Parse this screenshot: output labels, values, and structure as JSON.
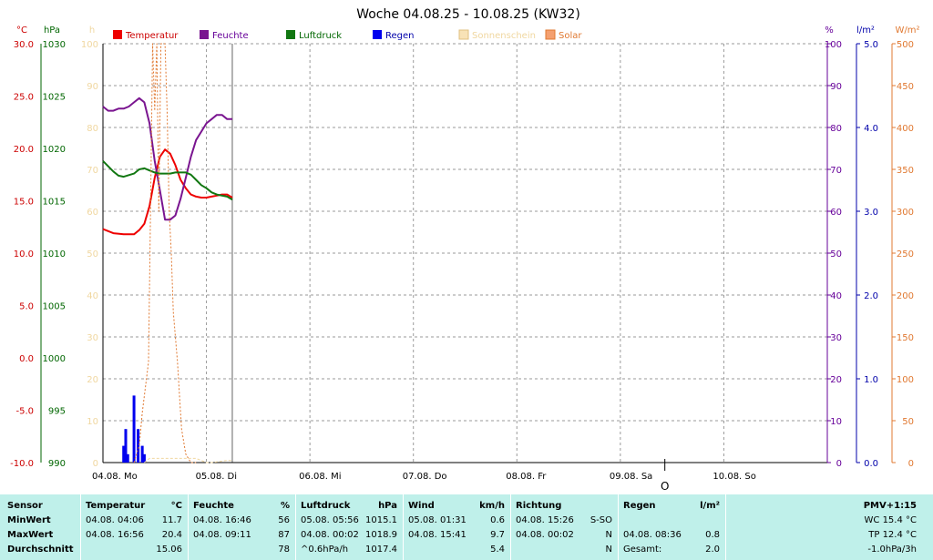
{
  "chart_data": {
    "type": "line",
    "title": "Woche 04.08.25 - 10.08.25 (KW32)",
    "x_days": [
      "04.08.  Mo",
      "05.08.  Di",
      "06.08.  Mi",
      "07.08.  Do",
      "08.08.  Fr",
      "09.08.  Sa",
      "10.08.  So"
    ],
    "x_range_days": [
      0,
      7
    ],
    "now_marker_day": 5.43,
    "now_marker_label": "O",
    "grid": true,
    "legend_position": "top",
    "axes": {
      "temp": {
        "unit": "°C",
        "range": [
          -10,
          30
        ],
        "ticks": [
          "30.0",
          "25.0",
          "20.0",
          "15.0",
          "10.0",
          "5.0",
          "0.0",
          "-5.0",
          "-10.0"
        ],
        "color": "#cc0000"
      },
      "press": {
        "unit": "hPa",
        "range": [
          990,
          1030
        ],
        "ticks": [
          "1030",
          "1025",
          "1020",
          "1015",
          "1010",
          "1005",
          "1000",
          "995",
          "990"
        ],
        "color": "#006600"
      },
      "sun": {
        "unit": "h",
        "range": [
          0,
          100
        ],
        "ticks": [
          "100",
          "90",
          "80",
          "70",
          "60",
          "50",
          "40",
          "30",
          "20",
          "10",
          "0"
        ],
        "color": "#f0d7a0"
      },
      "hum": {
        "unit": "%",
        "range": [
          0,
          100
        ],
        "ticks": [
          "100",
          "90",
          "80",
          "70",
          "60",
          "50",
          "40",
          "30",
          "20",
          "10",
          "0"
        ],
        "color": "#660099"
      },
      "rain": {
        "unit": "l/m²",
        "range": [
          0,
          5
        ],
        "ticks": [
          "5.0",
          "4.0",
          "3.0",
          "2.0",
          "1.0",
          "0.0"
        ],
        "color": "#0000aa"
      },
      "solar": {
        "unit": "W/m²",
        "range": [
          0,
          500
        ],
        "ticks": [
          "500",
          "450",
          "400",
          "350",
          "300",
          "250",
          "200",
          "150",
          "100",
          "50",
          "0"
        ],
        "color": "#e07830"
      }
    },
    "series": [
      {
        "name": "Temperatur",
        "axis": "temp",
        "color": "#ee0000",
        "style": "line",
        "x": [
          0,
          0.05,
          0.1,
          0.2,
          0.3,
          0.35,
          0.4,
          0.45,
          0.5,
          0.55,
          0.6,
          0.65,
          0.7,
          0.75,
          0.8,
          0.85,
          0.9,
          0.95,
          1.0,
          1.05,
          1.1,
          1.15,
          1.2,
          1.25
        ],
        "y": [
          12.3,
          12.1,
          11.9,
          11.8,
          11.8,
          12.2,
          12.8,
          14.5,
          17.2,
          19.2,
          19.9,
          19.5,
          18.4,
          17.0,
          16.2,
          15.6,
          15.4,
          15.3,
          15.3,
          15.4,
          15.5,
          15.6,
          15.6,
          15.3
        ]
      },
      {
        "name": "Feuchte",
        "axis": "hum",
        "color": "#7a1590",
        "style": "line",
        "x": [
          0,
          0.05,
          0.1,
          0.15,
          0.2,
          0.25,
          0.3,
          0.35,
          0.4,
          0.45,
          0.5,
          0.55,
          0.6,
          0.65,
          0.7,
          0.75,
          0.8,
          0.85,
          0.9,
          0.95,
          1.0,
          1.05,
          1.1,
          1.15,
          1.2,
          1.25
        ],
        "y": [
          85,
          84,
          84,
          84.5,
          84.5,
          85,
          86,
          87,
          86,
          81,
          72,
          65,
          58,
          58,
          59,
          63,
          68,
          73,
          77,
          79,
          81,
          82,
          83,
          83,
          82,
          82
        ]
      },
      {
        "name": "Luftdruck",
        "axis": "press",
        "color": "#117711",
        "style": "line",
        "x": [
          0,
          0.05,
          0.1,
          0.15,
          0.2,
          0.3,
          0.35,
          0.4,
          0.45,
          0.5,
          0.55,
          0.6,
          0.65,
          0.7,
          0.75,
          0.8,
          0.85,
          0.9,
          0.95,
          1.0,
          1.05,
          1.1,
          1.15,
          1.2,
          1.25
        ],
        "y": [
          1018.8,
          1018.3,
          1017.8,
          1017.4,
          1017.3,
          1017.6,
          1018.0,
          1018.1,
          1017.9,
          1017.7,
          1017.6,
          1017.6,
          1017.6,
          1017.7,
          1017.7,
          1017.7,
          1017.5,
          1017.0,
          1016.5,
          1016.2,
          1015.8,
          1015.6,
          1015.5,
          1015.4,
          1015.1
        ]
      },
      {
        "name": "Regen",
        "axis": "rain",
        "color": "#0000ee",
        "style": "bars",
        "x": [
          0.2,
          0.22,
          0.24,
          0.3,
          0.34,
          0.38,
          0.4
        ],
        "y": [
          0.2,
          0.4,
          0.1,
          0.8,
          0.4,
          0.2,
          0.1
        ]
      },
      {
        "name": "Sonnenschein",
        "axis": "sun",
        "color": "#f0d7a0",
        "style": "line",
        "x": [
          0.4,
          0.45,
          0.5,
          0.6,
          0.7,
          0.8,
          0.9,
          1.0,
          1.05,
          1.2,
          1.25
        ],
        "y": [
          0,
          1,
          1,
          1,
          1,
          1,
          1,
          0,
          0,
          0.5,
          0.5
        ]
      },
      {
        "name": "Solar",
        "axis": "solar",
        "color": "#e07830",
        "style": "dash",
        "x": [
          0.3,
          0.35,
          0.38,
          0.41,
          0.44,
          0.46,
          0.48,
          0.5,
          0.52,
          0.54,
          0.56,
          0.58,
          0.6,
          0.62,
          0.64,
          0.66,
          0.68,
          0.7,
          0.72,
          0.74,
          0.76,
          0.8,
          0.85,
          0.9
        ],
        "y": [
          0,
          20,
          60,
          90,
          120,
          300,
          500,
          420,
          500,
          300,
          500,
          500,
          500,
          420,
          300,
          250,
          180,
          150,
          120,
          80,
          40,
          10,
          0,
          0
        ]
      }
    ]
  },
  "stats": {
    "headers": {
      "sensor": "Sensor",
      "temp": "Temperatur",
      "temp_unit": "°C",
      "hum": "Feuchte",
      "hum_unit": "%",
      "press": "Luftdruck",
      "press_unit": "hPa",
      "wind": "Wind",
      "wind_unit": "km/h",
      "dir": "Richtung",
      "rain": "Regen",
      "rain_unit": "l/m²",
      "pmv": "PMV+1:15"
    },
    "rows": {
      "min": {
        "label": "MinWert",
        "temp_time": "04.08.  04:06",
        "temp_val": "11.7",
        "hum_time": "04.08.  16:46",
        "hum_val": "56",
        "press_time": "05.08.  05:56",
        "press_val": "1015.1",
        "wind_time": "05.08.  01:31",
        "wind_val": "0.6",
        "dir_time": "04.08.  15:26",
        "dir_val": "S-SO",
        "rain_time": "",
        "rain_val": "",
        "extra": "WC 15.4 °C"
      },
      "max": {
        "label": "MaxWert",
        "temp_time": "04.08.  16:56",
        "temp_val": "20.4",
        "hum_time": "04.08.  09:11",
        "hum_val": "87",
        "press_time": "04.08.  00:02",
        "press_val": "1018.9",
        "wind_time": "04.08.  15:41",
        "wind_val": "9.7",
        "dir_time": "04.08.  00:02",
        "dir_val": "N",
        "rain_time": "04.08.  08:36",
        "rain_val": "0.8",
        "extra": "TP 12.4 °C"
      },
      "avg": {
        "label": "Durchschnitt",
        "temp_time": "",
        "temp_val": "15.06",
        "hum_time": "",
        "hum_val": "78",
        "press_time": "^0.6hPa/h",
        "press_val": "1017.4",
        "wind_time": "",
        "wind_val": "5.4",
        "dir_time": "",
        "dir_val": "N",
        "rain_time": "Gesamt:",
        "rain_val": "2.0",
        "extra": "-1.0hPa/3h"
      }
    }
  }
}
